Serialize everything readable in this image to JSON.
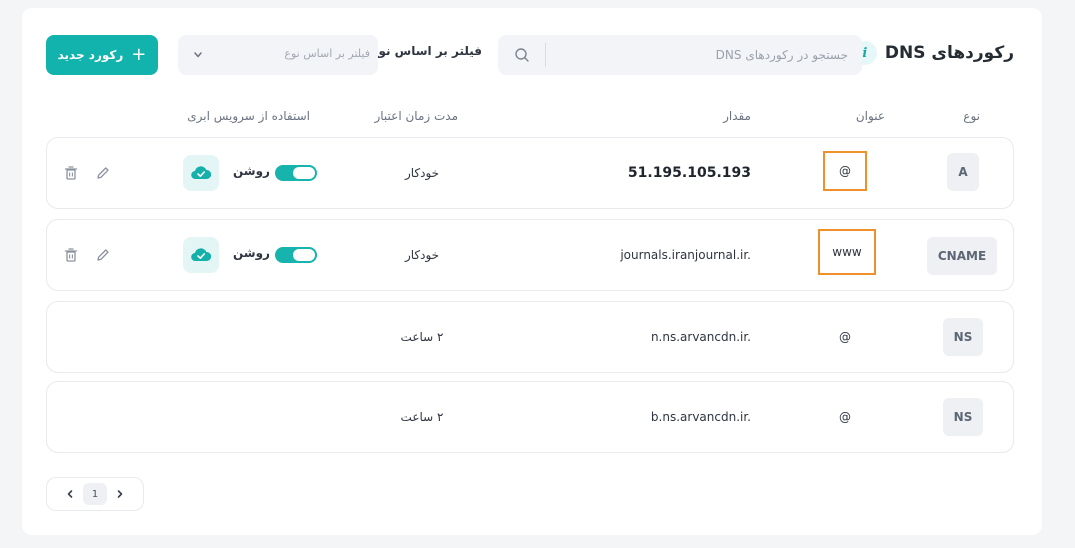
{
  "header": {
    "title": "رکوردهای DNS",
    "search_placeholder": "جستجو در رکوردهای DNS",
    "filter_label": "فیلتر بر اساس نوع",
    "filter_placeholder": "فیلتر بر اساس نوع",
    "new_record_label": "رکورد جدید"
  },
  "columns": {
    "type": "نوع",
    "name": "عنوان",
    "value": "مقدار",
    "ttl": "مدت زمان اعتبار",
    "cloud": "استفاده از سرویس ابری"
  },
  "records": [
    {
      "type": "A",
      "name": "@",
      "value": "51.195.105.193",
      "ttl": "خودکار",
      "cloud_label": "روشن",
      "cloud_enabled": true
    },
    {
      "type": "CNAME",
      "name": "www",
      "value": "journals.iranjournal.ir.",
      "ttl": "خودکار",
      "cloud_label": "روشن",
      "cloud_enabled": true
    },
    {
      "type": "NS",
      "name": "@",
      "value": "n.ns.arvancdn.ir.",
      "ttl": "۲ ساعت"
    },
    {
      "type": "NS",
      "name": "@",
      "value": "b.ns.arvancdn.ir.",
      "ttl": "۲ ساعت"
    }
  ],
  "pagination": {
    "current_page": "1"
  },
  "colors": {
    "accent": "#12b3ad",
    "highlight": "#f0902a",
    "background": "#f4f5f7"
  },
  "icons": [
    "info-icon",
    "search-icon",
    "chevron-down-icon",
    "plus-icon",
    "cloud-check-icon",
    "pencil-icon",
    "trash-icon",
    "chevron-left-icon",
    "chevron-right-icon"
  ]
}
